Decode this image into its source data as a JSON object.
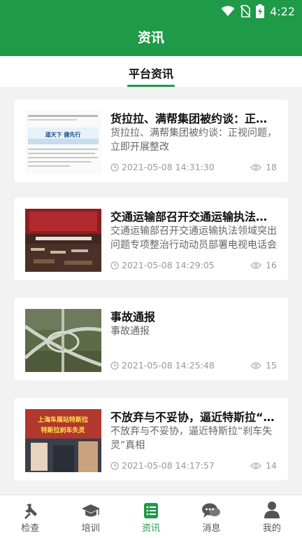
{
  "status_bar": {
    "time": "4:22"
  },
  "header": {
    "title": "资讯"
  },
  "tabs": [
    {
      "label": "平台资讯",
      "active": true
    }
  ],
  "articles": [
    {
      "title": "货拉拉、满帮集团被约谈：正视问题，立即开展整改",
      "summary": "货拉拉、满帮集团被约谈：正视问题，立即开展整改",
      "date": "2021-05-08 14:31:30",
      "views": "18",
      "thumb_text": [
        "道天下  健先行"
      ]
    },
    {
      "title": "交通运输部召开交通运输执法领域突出问题专项整治行动动员部署电视电话会议",
      "summary": "交通运输部召开交通运输执法领域突出问题专项整治行动动员部署电视电话会议",
      "date": "2021-05-08 14:29:05",
      "views": "16"
    },
    {
      "title": "事故通报",
      "summary": "事故通报",
      "date": "2021-05-08 14:25:48",
      "views": "15"
    },
    {
      "title": "不放弃与不妥协，逼近特斯拉“刹车失灵”真相",
      "summary": "不放弃与不妥协，逼近特斯拉“刹车失灵”真相",
      "date": "2021-05-08 14:17:57",
      "views": "14",
      "thumb_text": [
        "上海车展站特斯拉",
        "特斯拉刹车失灵"
      ]
    }
  ],
  "bottom_nav": [
    {
      "label": "检查",
      "icon": "wrench-icon",
      "active": false
    },
    {
      "label": "培训",
      "icon": "graduation-cap-icon",
      "active": false
    },
    {
      "label": "资讯",
      "icon": "news-list-icon",
      "active": true
    },
    {
      "label": "消息",
      "icon": "chat-bubbles-icon",
      "active": false
    },
    {
      "label": "我的",
      "icon": "user-icon",
      "active": false
    }
  ],
  "colors": {
    "brand_green": "#1e9a48",
    "text_primary": "#111111",
    "text_secondary": "#666666",
    "text_meta": "#999999"
  }
}
